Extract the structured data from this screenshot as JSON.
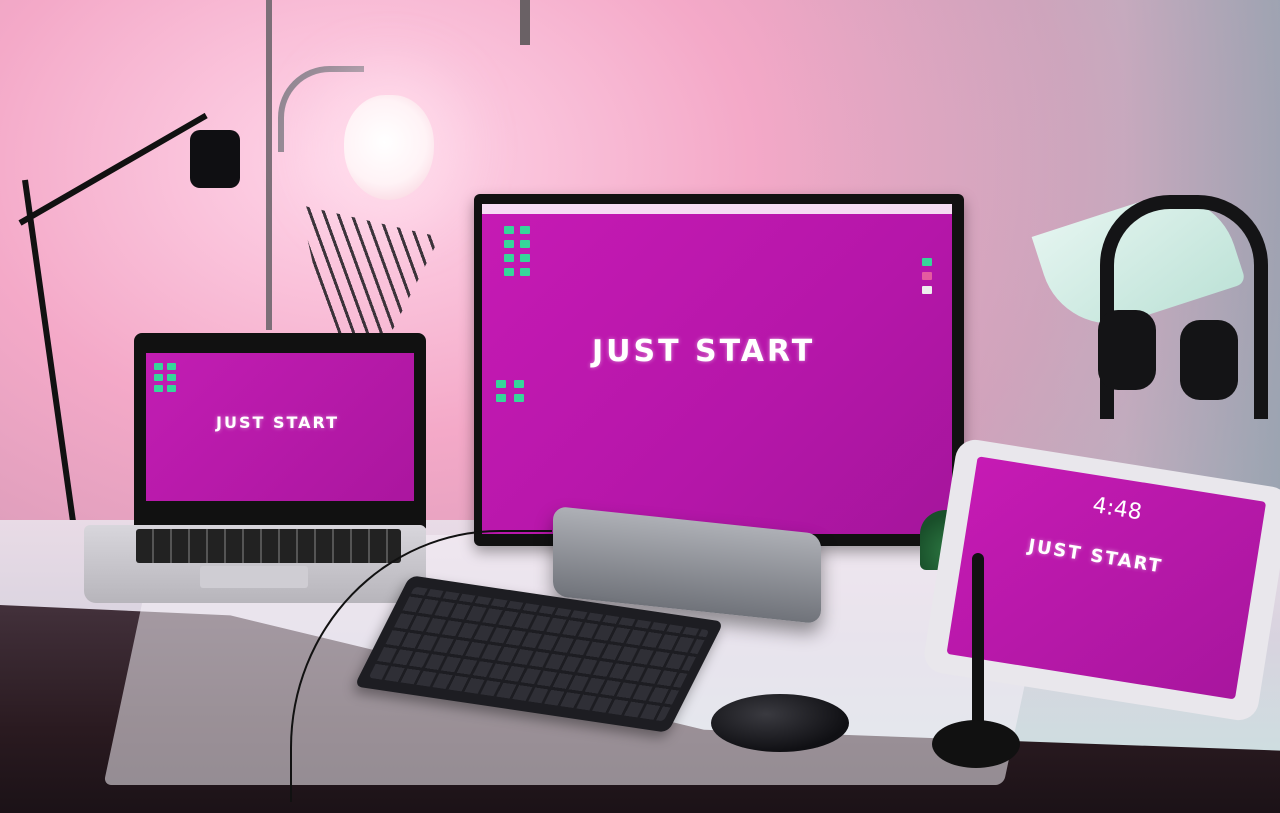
{
  "scene": {
    "type": "desk setup photo",
    "lighting_colors": {
      "pink": "#f4a9c8",
      "teal": "#9fd6cc",
      "screen_magenta": "#c61ab4",
      "icon_green": "#36d69a"
    }
  },
  "monitor": {
    "wallpaper_text": "JUST START"
  },
  "laptop": {
    "wallpaper_text": "JUST START"
  },
  "tablet": {
    "time": "4:48",
    "wallpaper_text": "JUST START"
  },
  "icons": {
    "monitor_desk_icon": "folder-icon",
    "laptop_desk_icon": "folder-icon"
  }
}
